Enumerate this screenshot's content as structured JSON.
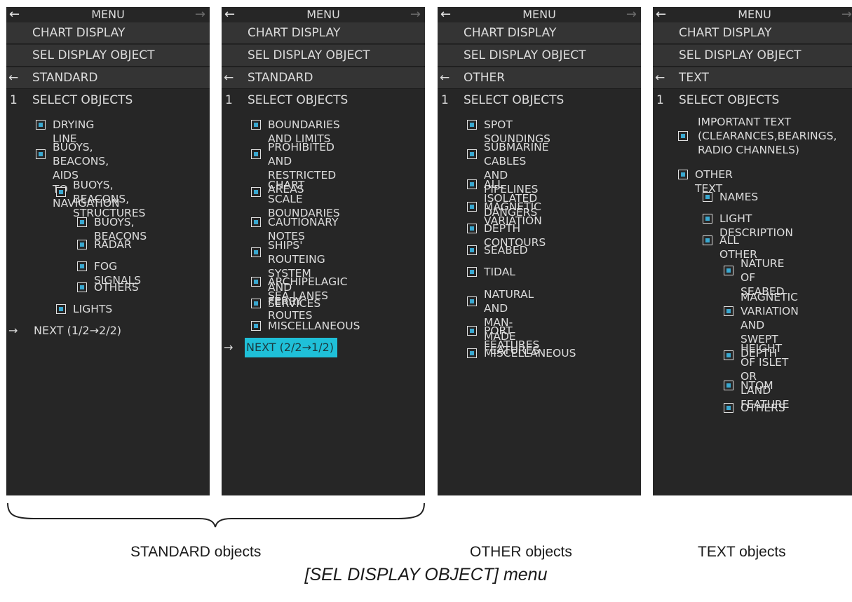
{
  "menu": {
    "title": "MENU",
    "back_glyph": "←",
    "forward_glyph": "→",
    "lead_arrow": "←",
    "next_arrow": "→"
  },
  "panels": [
    {
      "chart_display": "CHART DISPLAY",
      "sel_display_object": "SEL DISPLAY OBJECT",
      "section": "STANDARD",
      "select_num": "1",
      "select_objects": "SELECT OBJECTS",
      "items": [
        "DRYING LINE",
        "BUOYS, BEACONS, AIDS\nTO NAVIGATION",
        "BUOYS, BEACONS,\nSTRUCTURES",
        "BUOYS, BEACONS",
        "RADAR",
        "FOG SIGNALS",
        "OTHERS",
        "LIGHTS"
      ],
      "next": "NEXT (1/2→2/2)"
    },
    {
      "chart_display": "CHART DISPLAY",
      "sel_display_object": "SEL DISPLAY OBJECT",
      "section": "STANDARD",
      "select_num": "1",
      "select_objects": "SELECT OBJECTS",
      "items": [
        "BOUNDARIES AND LIMITS",
        "PROHIBITED AND\nRESTRICTED AREAS",
        "CHART SCALE\nBOUNDARIES",
        "CAUTIONARY NOTES",
        "SHIPS' ROUTEING SYSTEM\nAND FERRY ROUTES",
        "ARCHIPELAGIC SEA LANES",
        "SERVICES",
        "MISCELLANEOUS"
      ],
      "next": "NEXT (2/2→1/2)"
    },
    {
      "chart_display": "CHART DISPLAY",
      "sel_display_object": "SEL DISPLAY OBJECT",
      "section": "OTHER",
      "select_num": "1",
      "select_objects": "SELECT OBJECTS",
      "items": [
        "SPOT SOUNDINGS",
        "SUBMARINE CABLES AND\nPIPELINES",
        "ALL ISOLATED DANGERS",
        "MAGNETIC VARIATION",
        "DEPTH CONTOURS",
        "SEABED",
        "TIDAL",
        "NATURAL AND\nMAN-MADE FEATURES",
        "PORT FEATURES",
        "MISCELLANEOUS"
      ]
    },
    {
      "chart_display": "CHART DISPLAY",
      "sel_display_object": "SEL DISPLAY OBJECT",
      "section": "TEXT",
      "select_num": "1",
      "select_objects": "SELECT OBJECTS",
      "items": [
        "IMPORTANT TEXT\n(CLEARANCES,BEARINGS,\nRADIO CHANNELS)",
        "OTHER TEXT",
        "NAMES",
        "LIGHT DESCRIPTION",
        "ALL OTHER",
        "NATURE OF\nSEABED",
        "MAGNETIC\nVARIATION AND\nSWEPT DEPTH",
        "HEIGHT OF ISLET\nOR LAND FEATURE",
        "NTOM",
        "OTHERS"
      ]
    }
  ],
  "captions": {
    "standard": "STANDARD objects",
    "other": "OTHER objects",
    "text": "TEXT objects",
    "figure_title": "[SEL DISPLAY OBJECT] menu"
  },
  "colors": {
    "panel_bg": "#262626",
    "bar_bg": "#343434",
    "checkbox_fill": "#3aa8d0",
    "selection_highlight": "#1fc0d8"
  },
  "states": {
    "all_items_checked": true,
    "selected_row": "NEXT (2/2→1/2)"
  }
}
